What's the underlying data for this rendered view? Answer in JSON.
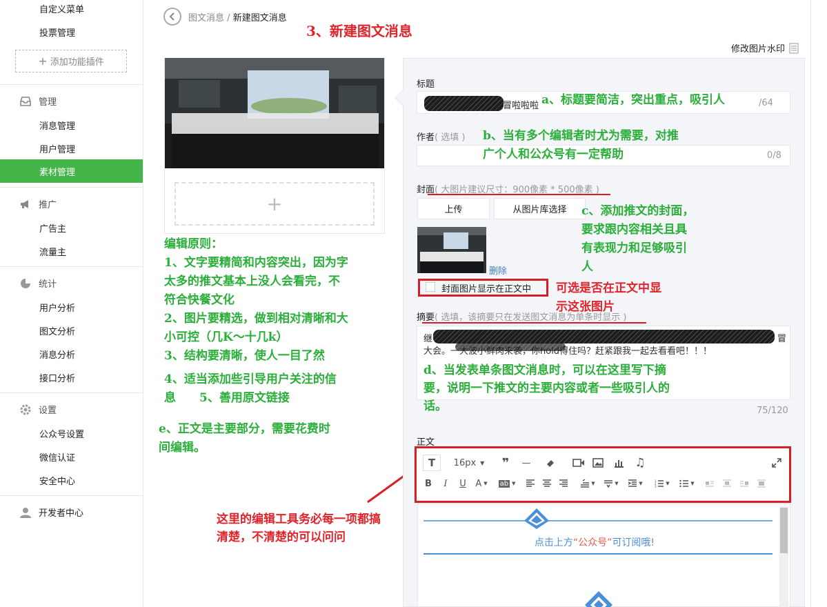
{
  "sidebar": {
    "menu_custom": "自定义菜单",
    "menu_vote": "投票管理",
    "add_plugin": "添加功能插件",
    "section_manage": "管理",
    "messages": "消息管理",
    "users": "用户管理",
    "materials": "素材管理",
    "section_promote": "推广",
    "advertiser": "广告主",
    "traffic": "流量主",
    "section_stats": "统计",
    "user_analysis": "用户分析",
    "article_analysis": "图文分析",
    "message_analysis": "消息分析",
    "api_analysis": "接口分析",
    "section_settings": "设置",
    "account_settings": "公众号设置",
    "wechat_verify": "微信认证",
    "security": "安全中心",
    "developer": "开发者中心"
  },
  "breadcrumb": {
    "parent": "图文消息",
    "sep": "/",
    "current": "新建图文消息"
  },
  "watermark_link": "修改图片水印",
  "form": {
    "title_label": "标题",
    "title_value": "冒啦啦啦",
    "title_count": "/64",
    "author_label": "作者",
    "author_hint": "( 选填 )",
    "author_count": "0/8",
    "cover_label": "封面",
    "cover_hint": "( 大图片建议尺寸：900像素 * 500像素 )",
    "upload_button": "上传",
    "library_button": "从图片库选择",
    "delete_link": "删除",
    "cover_checkbox_label": "封面图片显示在正文中",
    "summary_label": "摘要",
    "summary_hint": "( 选填，该摘要只在发送图文消息为单条时显示 )",
    "summary_value_1": "继",
    "summary_value_1_end": "冒",
    "summary_value_2": "大会。一大波小鲜肉来袭，你hold得住吗？赶紧跟我一起去看看吧！！！",
    "summary_count": "75/120",
    "body_label": "正文"
  },
  "editor": {
    "font_size": "16px",
    "body_text_pre": "点击上方",
    "body_text_highlight": "“公众号”",
    "body_text_post": "可订阅哦!"
  },
  "annotations": {
    "step3": "3、新建图文消息",
    "a": "a、标题要简洁，突出重点，吸引人",
    "b1": "b、当有多个编辑者时尤为需要，对推",
    "b2": "广个人和公众号有一定帮助",
    "c1": "c、添加推文的封面，",
    "c2": "要求跟内容相关且具",
    "c3": "有表现力和足够吸引",
    "c4": "人",
    "opt1": "可选是否在正文中显",
    "opt2": "示这张图片",
    "d1": "d、当发表单条图文消息时，可以在这里写下摘",
    "d2": "要，说明一下推文的主要内容或者一些吸引人的",
    "d3": "话。",
    "rules_title": "编辑原则：",
    "r1a": "1、文字要精简和内容突出，因为字",
    "r1b": "太多的推文基本上没人会看完，不",
    "r1c": "符合快餐文化",
    "r2a": "2、图片要精选，做到相对清晰和大",
    "r2b": "小可控（几K～十几k）",
    "r3": "3、结构要清晰，使人一目了然",
    "r4a": "4、适当添加些引导用户关注的信",
    "r4b": "息　　5、善用原文链接",
    "e1": "e、正文是主要部分，需要花费时",
    "e2": "间编辑。",
    "tool1": "这里的编辑工具务必每一项都搞",
    "tool2": "清楚，不清楚的可以问问"
  }
}
